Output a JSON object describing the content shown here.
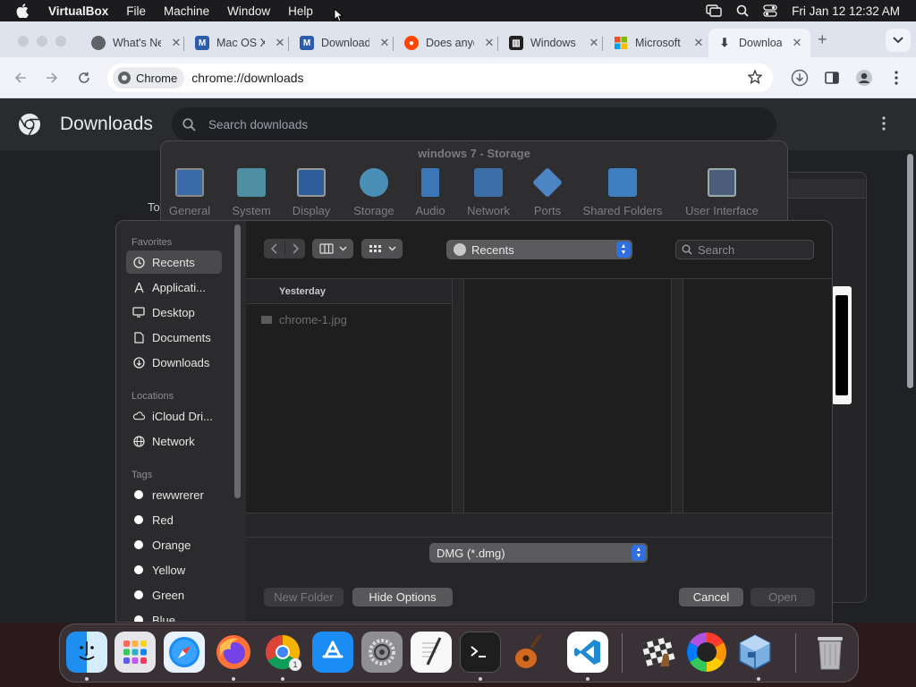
{
  "menubar": {
    "app_name": "VirtualBox",
    "menus": [
      "File",
      "Machine",
      "Window",
      "Help"
    ],
    "clock": "Fri Jan 12  12:32 AM"
  },
  "browser": {
    "tabs": [
      {
        "label": "What's New",
        "favicon": "chrome-icon"
      },
      {
        "label": "Mac OS X",
        "favicon": "virtualbox-doc-icon"
      },
      {
        "label": "Downloads",
        "favicon": "virtualbox-doc-icon"
      },
      {
        "label": "Does anyone",
        "favicon": "reddit-icon"
      },
      {
        "label": "Windows",
        "favicon": "archive-icon"
      },
      {
        "label": "Microsoft",
        "favicon": "microsoft-icon"
      },
      {
        "label": "Downloads",
        "favicon": "download-icon",
        "active": true
      }
    ],
    "site_chip": "Chrome",
    "url": "chrome://downloads"
  },
  "downloads_page": {
    "title": "Downloads",
    "search_placeholder": "Search downloads",
    "partial_text": "To"
  },
  "vbox_settings": {
    "title": "windows 7 - Storage",
    "sections": [
      "General",
      "System",
      "Display",
      "Storage",
      "Audio",
      "Network",
      "Ports",
      "Shared Folders",
      "User Interface"
    ]
  },
  "open_panel": {
    "sidebar": {
      "favorites_label": "Favorites",
      "favorites": [
        {
          "label": "Recents",
          "icon": "clock-icon",
          "selected": true
        },
        {
          "label": "Applicati...",
          "icon": "applications-icon"
        },
        {
          "label": "Desktop",
          "icon": "desktop-icon"
        },
        {
          "label": "Documents",
          "icon": "document-icon"
        },
        {
          "label": "Downloads",
          "icon": "download-circle-icon"
        }
      ],
      "locations_label": "Locations",
      "locations": [
        {
          "label": "iCloud Dri...",
          "icon": "cloud-icon"
        },
        {
          "label": "Network",
          "icon": "globe-icon"
        }
      ],
      "tags_label": "Tags",
      "tags": [
        "rewwrerer",
        "Red",
        "Orange",
        "Yellow",
        "Green",
        "Blue"
      ]
    },
    "location_popup": "Recents",
    "search_placeholder": "Search",
    "group_header": "Yesterday",
    "files": [
      "chrome-1.jpg"
    ],
    "format_popup": "DMG (*.dmg)",
    "buttons": {
      "new_folder": "New Folder",
      "hide_options": "Hide Options",
      "cancel": "Cancel",
      "open": "Open"
    }
  },
  "dock": {
    "apps": [
      "finder-icon",
      "launchpad-icon",
      "safari-icon",
      "firefox-icon",
      "chrome-icon",
      "app-store-icon",
      "system-settings-icon",
      "textedit-icon",
      "terminal-icon",
      "garageband-icon",
      "vscode-icon",
      "chess-icon",
      "color-wheel-icon",
      "virtualbox-icon",
      "trash-icon"
    ],
    "chrome_badge": "1"
  }
}
